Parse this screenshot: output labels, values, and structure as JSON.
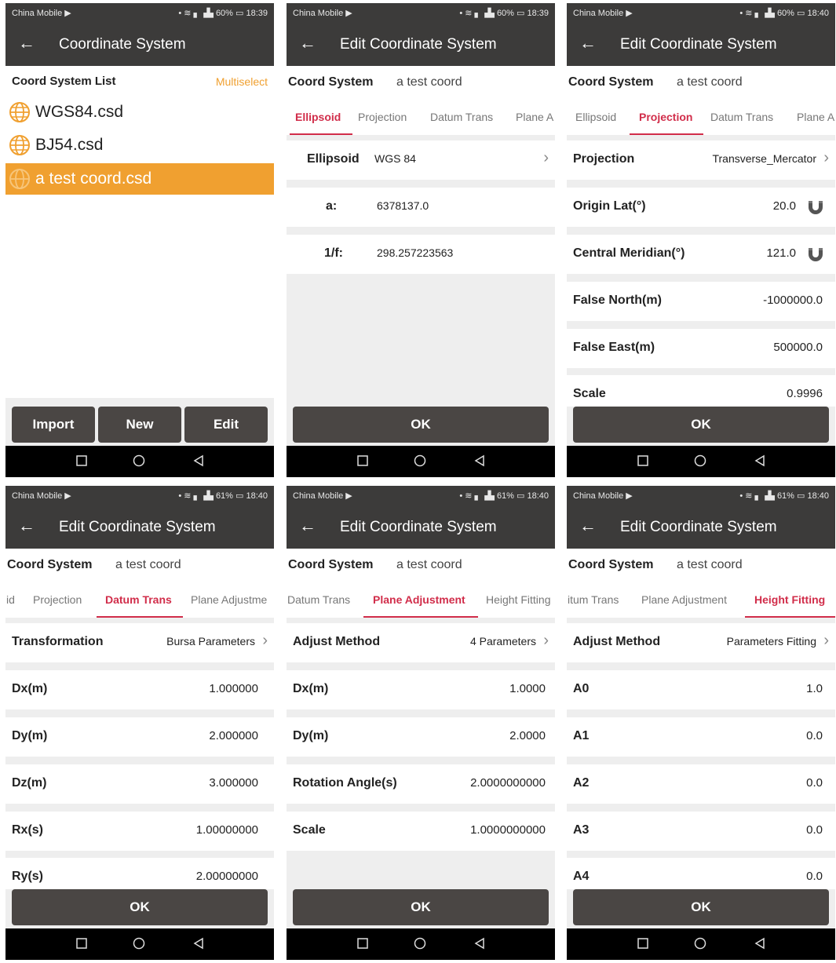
{
  "status": {
    "carrier": "China Mobile ▶",
    "p1": "• ≋ ▖▗▙ 60% ▭ 18:39",
    "p2": "• ≋ ▖▗▙ 60% ▭ 18:39",
    "p3": "• ≋ ▖▗▙ 60% ▭ 18:40",
    "p4": "• ≋ ▖▗▙ 61% ▭ 18:40",
    "p5": "• ≋ ▖▗▙ 61% ▭ 18:40",
    "p6": "• ≋ ▖▗▙ 61% ▭ 18:40"
  },
  "back_arrow": "←",
  "colors": {
    "bar": "#3c3b3a",
    "accent": "#f0a030",
    "tab_active": "#d12d4a",
    "button": "#4a4644"
  },
  "list_screen": {
    "title": "Coordinate System",
    "list_label": "Coord System List",
    "multiselect": "Multiselect",
    "files": [
      "WGS84.csd",
      "BJ54.csd",
      "a test coord.csd"
    ],
    "buttons": {
      "import": "Import",
      "new": "New",
      "edit": "Edit"
    }
  },
  "edit": {
    "title": "Edit Coordinate System",
    "cs_label": "Coord System",
    "cs_value": "a test coord",
    "ok": "OK"
  },
  "screen2": {
    "tabs": [
      "Ellipsoid",
      "Projection",
      "Datum Trans",
      "Plane A"
    ],
    "rows": [
      {
        "label": "Ellipsoid",
        "value": "WGS 84",
        "chevron": "›"
      },
      {
        "label": "a:",
        "value": "6378137.0"
      },
      {
        "label": "1/f:",
        "value": "298.257223563"
      }
    ]
  },
  "screen3": {
    "tabs": [
      "Ellipsoid",
      "Projection",
      "Datum Trans",
      "Plane A"
    ],
    "rows": [
      {
        "label": "Projection",
        "value": "Transverse_Mercator",
        "chevron": "›"
      },
      {
        "label": "Origin Lat(°)",
        "value": "20.0"
      },
      {
        "label": "Central Meridian(°)",
        "value": "121.0"
      },
      {
        "label": "False North(m)",
        "value": "-1000000.0"
      },
      {
        "label": "False East(m)",
        "value": "500000.0"
      },
      {
        "label": "Scale",
        "value": "0.9996"
      }
    ]
  },
  "screen4": {
    "tabs": [
      "id",
      "Projection",
      "Datum Trans",
      "Plane Adjustme"
    ],
    "rows": [
      {
        "label": "Transformation",
        "value": "Bursa Parameters",
        "chevron": "›"
      },
      {
        "label": "Dx(m)",
        "value": "1.000000"
      },
      {
        "label": "Dy(m)",
        "value": "2.000000"
      },
      {
        "label": "Dz(m)",
        "value": "3.000000"
      },
      {
        "label": "Rx(s)",
        "value": "1.00000000"
      },
      {
        "label": "Ry(s)",
        "value": "2.00000000"
      }
    ]
  },
  "screen5": {
    "tabs": [
      "Datum Trans",
      "Plane Adjustment",
      "Height Fitting"
    ],
    "rows": [
      {
        "label": "Adjust Method",
        "value": "4 Parameters",
        "chevron": "›"
      },
      {
        "label": "Dx(m)",
        "value": "1.0000"
      },
      {
        "label": "Dy(m)",
        "value": "2.0000"
      },
      {
        "label": "Rotation Angle(s)",
        "value": "2.0000000000"
      },
      {
        "label": "Scale",
        "value": "1.0000000000"
      }
    ]
  },
  "screen6": {
    "tabs": [
      "itum Trans",
      "Plane Adjustment",
      "Height Fitting"
    ],
    "rows": [
      {
        "label": "Adjust Method",
        "value": "Parameters Fitting",
        "chevron": "›"
      },
      {
        "label": "A0",
        "value": "1.0"
      },
      {
        "label": "A1",
        "value": "0.0"
      },
      {
        "label": "A2",
        "value": "0.0"
      },
      {
        "label": "A3",
        "value": "0.0"
      },
      {
        "label": "A4",
        "value": "0.0"
      }
    ]
  }
}
